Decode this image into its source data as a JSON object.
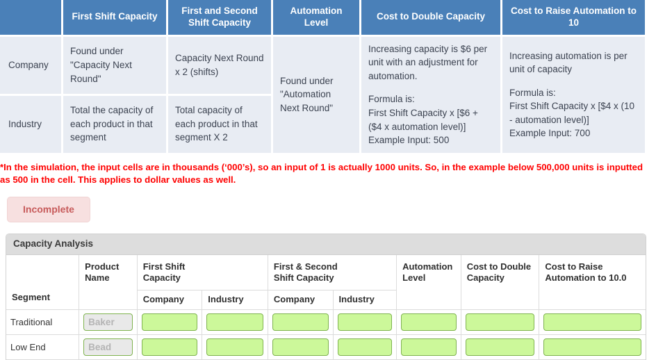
{
  "reference_table": {
    "headers": [
      "",
      "First Shift Capacity",
      "First and Second Shift Capacity",
      "Automation Level",
      "Cost to Double Capacity",
      "Cost to Raise Automation to 10"
    ],
    "rows": [
      {
        "label": "Company",
        "first_shift_capacity": "Found under\n\"Capacity Next Round\"",
        "first_and_second_shift_capacity": "Capacity Next Round x 2 (shifts)",
        "automation_level": "Found under \"Automation Next Round\"",
        "cost_to_double_capacity_intro": "Increasing capacity is $6 per unit with an adjustment for automation.",
        "cost_to_double_capacity_formula": "Formula is:\nFirst Shift Capacity x [$6 + ($4 x automation level)]\nExample Input: 500",
        "cost_to_raise_automation_intro": "Increasing automation is per unit of capacity",
        "cost_to_raise_automation_formula": "Formula is:\nFirst Shift Capacity x [$4 x (10 - automation level)]\nExample Input: 700"
      },
      {
        "label": "Industry",
        "first_shift_capacity": "Total the capacity of each product in that segment",
        "first_and_second_shift_capacity": "Total capacity of each product in that segment X 2"
      }
    ]
  },
  "note": {
    "text": "*In the simulation, the input cells are in thousands (‘000’s), so an input of 1 is actually 1000 units. So, in the example below 500,000 units is inputted as 500 in the cell. This applies to dollar values as well."
  },
  "status": {
    "label": "Incomplete"
  },
  "capacity_analysis": {
    "title": "Capacity Analysis",
    "headers": {
      "segment": "Segment",
      "product_name": "Product\nName",
      "first_shift_capacity": "First Shift\nCapacity",
      "first_and_second_shift_capacity": "First & Second\nShift Capacity",
      "automation_level": "Automation\nLevel",
      "cost_to_double_capacity": "Cost to Double\nCapacity",
      "cost_to_raise_automation": "Cost to Raise\nAutomation to 10.0"
    },
    "subheaders": {
      "fsc_company": "Company",
      "fsc_industry": "Industry",
      "fssc_company": "Company",
      "fssc_industry": "Industry"
    },
    "rows": [
      {
        "segment": "Traditional",
        "product_name": "Baker",
        "fsc_company": "",
        "fsc_industry": "",
        "fssc_company": "",
        "fssc_industry": "",
        "automation_level": "",
        "cost_to_double_capacity": "",
        "cost_to_raise_automation": ""
      },
      {
        "segment": "Low End",
        "product_name": "Bead",
        "fsc_company": "",
        "fsc_industry": "",
        "fssc_company": "",
        "fssc_industry": "",
        "automation_level": "",
        "cost_to_double_capacity": "",
        "cost_to_raise_automation": ""
      }
    ]
  },
  "colors": {
    "header_blue": "#4a80b8",
    "cell_blue_gray": "#e8ecf3",
    "note_red": "#ff0000",
    "badge_bg": "#f7e0e0",
    "badge_text": "#c75b5b",
    "input_green": "#ccf89a",
    "input_green_border": "#7fb34f",
    "panel_title_gray": "#dddddd"
  }
}
